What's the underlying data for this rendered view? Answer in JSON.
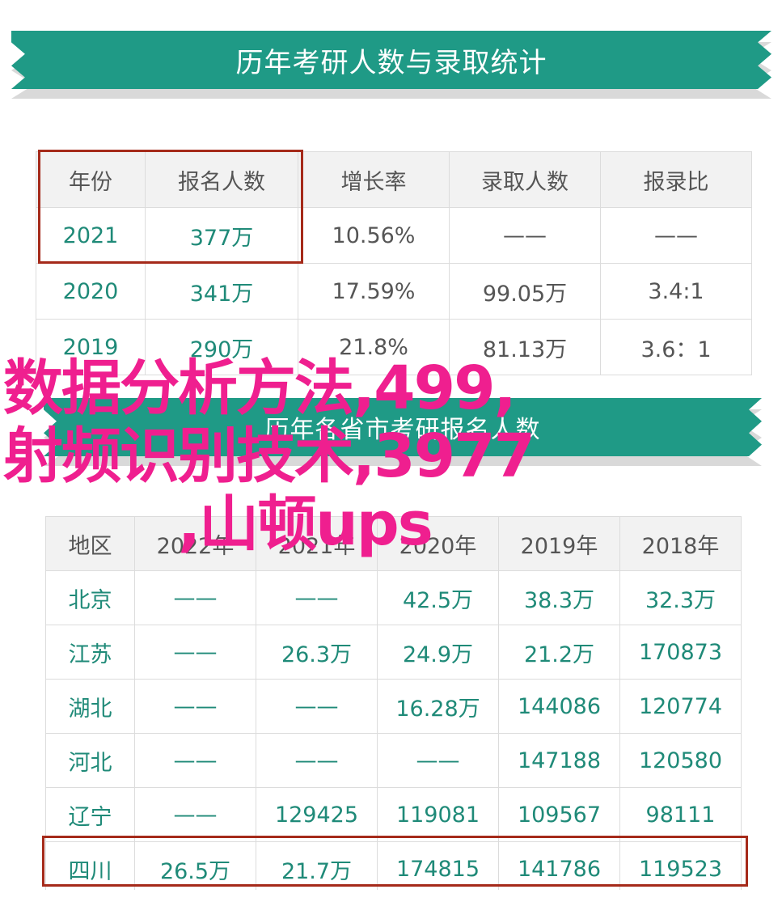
{
  "banner1": {
    "title": "历年考研人数与录取统计"
  },
  "banner2": {
    "title": "历年各省市考研报名人数"
  },
  "table1": {
    "headers": [
      "年份",
      "报名人数",
      "增长率",
      "录取人数",
      "报录比"
    ],
    "rows": [
      [
        "2021",
        "377万",
        "10.56%",
        "——",
        "——"
      ],
      [
        "2020",
        "341万",
        "17.59%",
        "99.05万",
        "3.4:1"
      ],
      [
        "2019",
        "290万",
        "21.8%",
        "81.13万",
        "3.6：1"
      ]
    ]
  },
  "table2": {
    "headers": [
      "地区",
      "2022年",
      "2021年",
      "2020年",
      "2019年",
      "2018年"
    ],
    "rows": [
      [
        "北京",
        "——",
        "——",
        "42.5万",
        "38.3万",
        "32.3万"
      ],
      [
        "江苏",
        "——",
        "26.3万",
        "24.9万",
        "21.2万",
        "170873"
      ],
      [
        "湖北",
        "——",
        "——",
        "16.28万",
        "144086",
        "120774"
      ],
      [
        "河北",
        "——",
        "——",
        "——",
        "147188",
        "120580"
      ],
      [
        "辽宁",
        "——",
        "129425",
        "119081",
        "109567",
        "98111"
      ],
      [
        "四川",
        "26.5万",
        "21.7万",
        "174815",
        "141786",
        "119523"
      ]
    ]
  },
  "overlay": {
    "line1": "数据分析方法,499,",
    "line2": "射频识别技术,3977",
    "line3": ",山顿ups"
  },
  "colors": {
    "accent": "#1f9a86",
    "highlight_box": "#a52a1a",
    "overlay_text": "#ef1f8f"
  }
}
